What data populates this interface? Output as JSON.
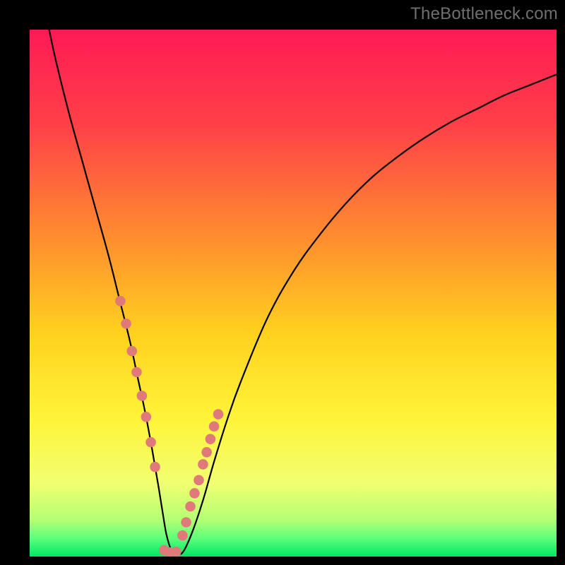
{
  "watermark": "TheBottleneck.com",
  "colors": {
    "background": "#000000",
    "curve_stroke": "#000000",
    "marker_fill": "#e07a7a",
    "watermark": "#6f6f6f"
  },
  "chart_data": {
    "type": "line",
    "title": "",
    "xlabel": "",
    "ylabel": "",
    "xlim": [
      0,
      100
    ],
    "ylim": [
      0,
      100
    ],
    "gradient_stops": [
      {
        "offset": 0,
        "color": "#ff1a55"
      },
      {
        "offset": 18,
        "color": "#ff4048"
      },
      {
        "offset": 40,
        "color": "#ff8f2e"
      },
      {
        "offset": 58,
        "color": "#ffd21f"
      },
      {
        "offset": 74,
        "color": "#fff43a"
      },
      {
        "offset": 86,
        "color": "#f1ff70"
      },
      {
        "offset": 93,
        "color": "#b4ff74"
      },
      {
        "offset": 96.5,
        "color": "#5eff7a"
      },
      {
        "offset": 100,
        "color": "#00e765"
      }
    ],
    "series": [
      {
        "name": "bottleneck-curve",
        "x": [
          3.7,
          5,
          7.5,
          10,
          12.5,
          15,
          17,
          19,
          20.5,
          22,
          23.3,
          24.5,
          25.3,
          26,
          27,
          28,
          29.2,
          31,
          33,
          35,
          37.5,
          40,
          45,
          50,
          55,
          60,
          65,
          70,
          75,
          80,
          85,
          90,
          95,
          100
        ],
        "y": [
          100,
          94,
          84,
          75,
          66,
          57,
          49,
          41,
          34,
          27,
          20,
          13,
          8,
          4,
          1,
          0.5,
          1,
          5,
          11,
          18,
          26,
          33,
          45,
          54,
          61,
          67,
          72,
          76,
          79.5,
          82.5,
          85,
          87.5,
          89.5,
          91.5
        ]
      }
    ],
    "markers": {
      "name": "highlight-dots",
      "x": [
        17.2,
        18.3,
        19.4,
        20.3,
        21.3,
        22.1,
        23.0,
        23.8,
        25.5,
        26.5,
        27.8,
        29.0,
        29.7,
        30.5,
        31.3,
        32.1,
        32.9,
        33.6,
        34.3,
        35.0,
        35.8
      ],
      "y": [
        48.5,
        44.2,
        39.0,
        35.0,
        30.5,
        26.5,
        21.7,
        17.0,
        1.2,
        0.8,
        0.9,
        4.0,
        6.5,
        9.5,
        12.0,
        14.5,
        17.5,
        19.8,
        22.3,
        24.7,
        27.0
      ]
    }
  }
}
